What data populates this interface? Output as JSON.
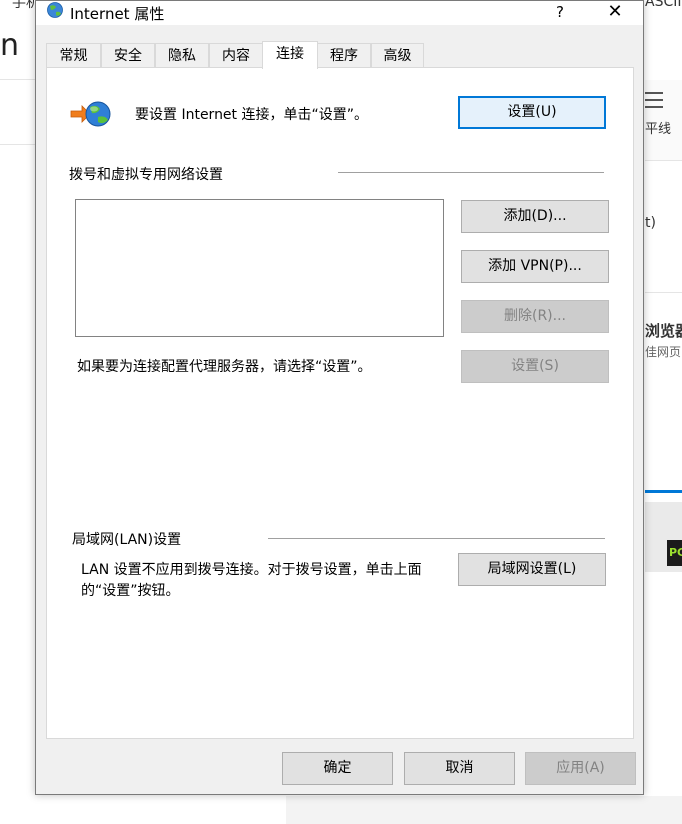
{
  "background": {
    "fragment_top_left": "手机",
    "fragment_big_letter": "n",
    "fragment_top_right": "ASCII",
    "fragment_right_1": "平线",
    "fragment_right_2": "t)",
    "fragment_right_3": "浏览器",
    "fragment_right_4": "佳网页",
    "badge": "PC"
  },
  "dialog": {
    "title": "Internet 属性",
    "help_label": "?",
    "close_label": "✕",
    "tabs": [
      {
        "label": "常规"
      },
      {
        "label": "安全"
      },
      {
        "label": "隐私"
      },
      {
        "label": "内容"
      },
      {
        "label": "连接"
      },
      {
        "label": "程序"
      },
      {
        "label": "高级"
      }
    ],
    "active_tab": "连接",
    "setup": {
      "text": "要设置 Internet 连接，单击“设置”。",
      "button": "设置(U)",
      "icon": "internet-connection-globe-icon"
    },
    "dialup": {
      "heading": "拨号和虚拟专用网络设置",
      "connections": [],
      "add_button": "添加(D)...",
      "add_vpn_button": "添加 VPN(P)...",
      "remove_button": "删除(R)...",
      "settings_button": "设置(S)",
      "proxy_text": "如果要为连接配置代理服务器，请选择“设置”。"
    },
    "lan": {
      "heading": "局域网(LAN)设置",
      "text": "LAN 设置不应用到拨号连接。对于拨号设置，单击上面的“设置”按钮。",
      "button": "局域网设置(L)"
    },
    "footer": {
      "ok": "确定",
      "cancel": "取消",
      "apply": "应用(A)"
    }
  },
  "colors": {
    "dialog_bg": "#f0f0f0",
    "accent": "#0078d7",
    "disabled_text": "#838383"
  }
}
